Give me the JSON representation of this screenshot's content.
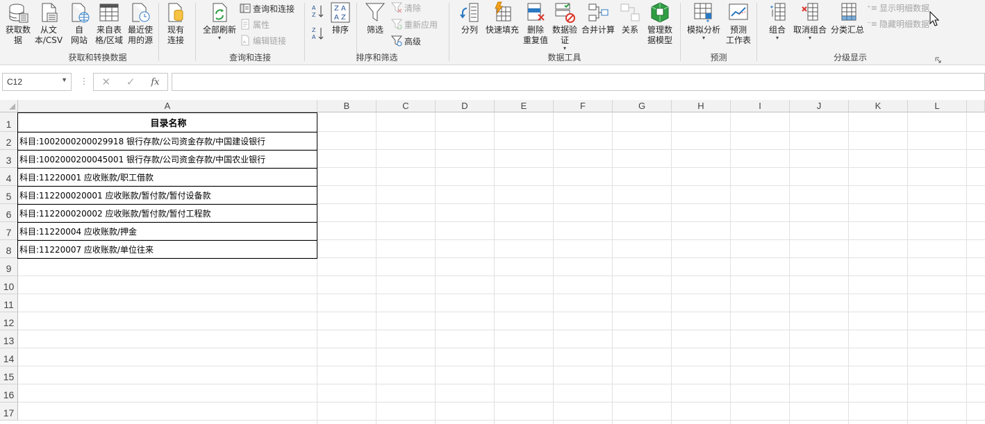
{
  "ribbon": {
    "groups": {
      "get_transform": "获取和转换数据",
      "queries": "查询和连接",
      "sort_filter": "排序和筛选",
      "data_tools": "数据工具",
      "forecast": "预测",
      "outline": "分级显示"
    },
    "buttons": {
      "get_data": "获取数\n据",
      "from_text": "从文\n本/CSV",
      "from_web": "自\n网站",
      "from_table": "来自表\n格/区域",
      "recent_sources": "最近使\n用的源",
      "existing_conn": "现有\n连接",
      "refresh_all": "全部刷新",
      "queries_conn": "查询和连接",
      "properties": "属性",
      "edit_links": "编辑链接",
      "sort": "排序",
      "filter": "筛选",
      "clear": "清除",
      "reapply": "重新应用",
      "advanced": "高级",
      "text_to_columns": "分列",
      "flash_fill": "快速填充",
      "remove_dup": "删除\n重复值",
      "data_validation": "数据验\n证",
      "consolidate": "合并计算",
      "relationships": "关系",
      "manage_model": "管理数\n据模型",
      "what_if": "模拟分析",
      "forecast_sheet": "预测\n工作表",
      "group": "组合",
      "ungroup": "取消组合",
      "subtotal": "分类汇总",
      "show_detail": "显示明细数据",
      "hide_detail": "隐藏明细数据"
    }
  },
  "formula_bar": {
    "name_box": "C12",
    "cancel_icon": "✕",
    "enter_icon": "✓",
    "fx_label": "fx",
    "formula": ""
  },
  "sheet": {
    "columns": [
      "A",
      "B",
      "C",
      "D",
      "E",
      "F",
      "G",
      "H",
      "I",
      "J",
      "K",
      "L"
    ],
    "rows": [
      "1",
      "2",
      "3",
      "4",
      "5",
      "6",
      "7",
      "8",
      "9",
      "10",
      "11",
      "12",
      "13",
      "14",
      "15",
      "16",
      "17"
    ],
    "cells": {
      "A1": "目录名称",
      "A2": "科目:1002000200029918 银行存款/公司资金存款/中国建设银行",
      "A3": "科目:1002000200045001 银行存款/公司资金存款/中国农业银行",
      "A4": "科目:11220001 应收账款/职工借款",
      "A5": "科目:112200020001 应收账款/暂付款/暂付设备款",
      "A6": "科目:112200020002 应收账款/暂付款/暂付工程款",
      "A7": "科目:11220004 应收账款/押金",
      "A8": "科目:11220007 应收账款/单位往来"
    }
  }
}
